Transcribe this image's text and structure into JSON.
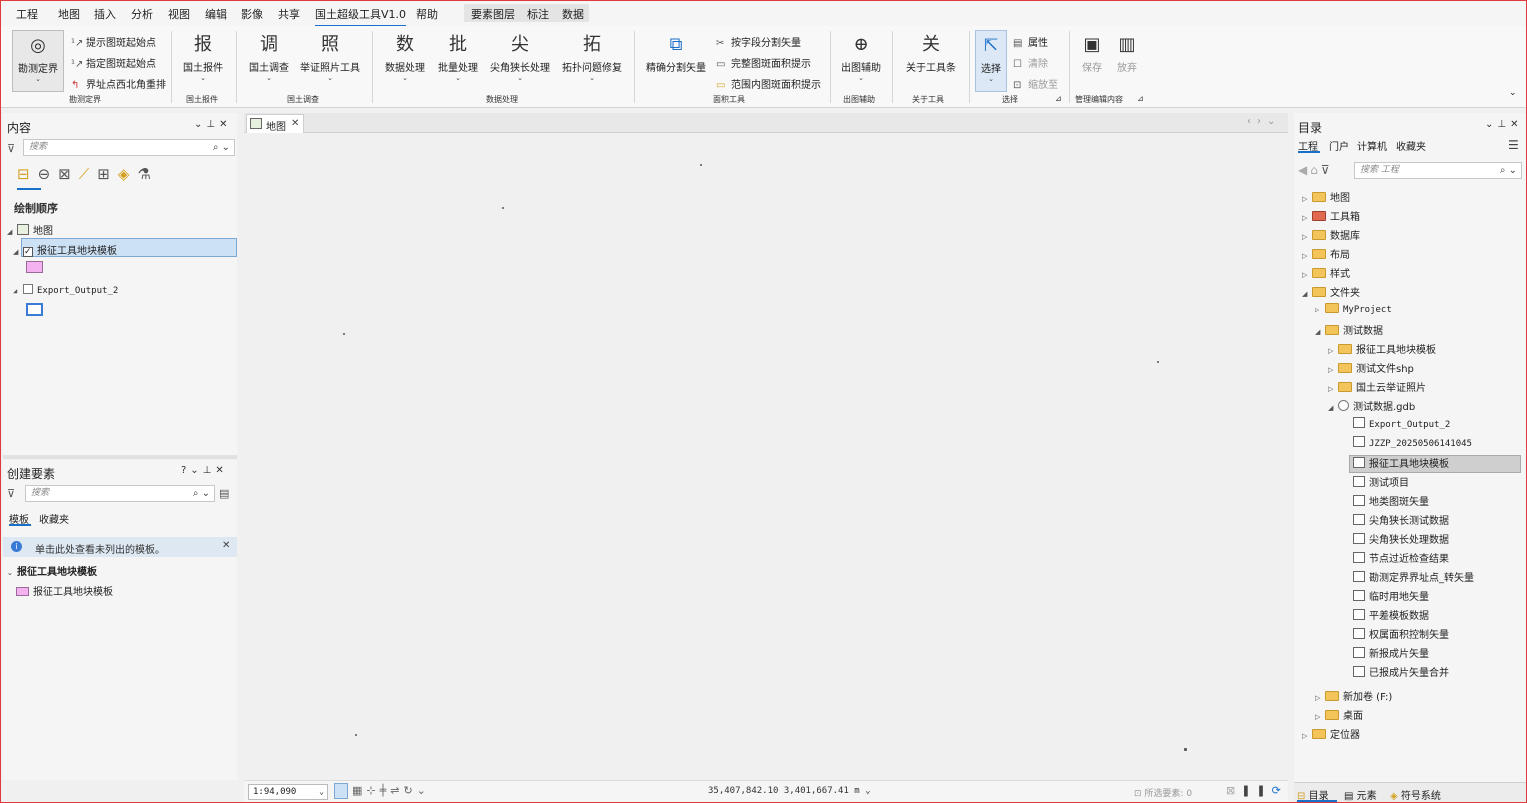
{
  "menu": [
    "工程",
    "地图",
    "插入",
    "分析",
    "视图",
    "编辑",
    "影像",
    "共享",
    "国土超级工具V1.0",
    "帮助"
  ],
  "context_tabs": [
    "要素图层",
    "标注",
    "数据"
  ],
  "ribbon": {
    "kcjd": {
      "big": "勘测定界",
      "items": [
        "提示图斑起始点",
        "指定图斑起始点",
        "界址点西北角重排"
      ],
      "group": "勘测定界"
    },
    "gtcj": {
      "big": "国土报件",
      "group": "国土报件"
    },
    "gtdc": {
      "big1": "国土调查",
      "big2": "举证照片工具",
      "group": "国土调查"
    },
    "sjcl": {
      "b1": "数据处理",
      "b2": "批量处理",
      "b3": "尖角狭长处理",
      "b4": "拓扑问题修复",
      "group": "数据处理"
    },
    "mjgj": {
      "big": "精确分割矢量",
      "items": [
        "按字段分割矢量",
        "完整图斑面积提示",
        "范围内图斑面积提示"
      ],
      "group": "面积工具"
    },
    "ctfz": {
      "big": "出图辅助",
      "group": "出图辅助"
    },
    "gygj": {
      "big": "关于工具条",
      "group": "关于工具"
    },
    "xz": {
      "big": "选择",
      "items": [
        "属性",
        "清除",
        "缩放至"
      ],
      "group": "选择"
    },
    "glbj": {
      "b1": "保存",
      "b2": "放弃",
      "group": "管理编辑内容"
    }
  },
  "contents": {
    "title": "内容",
    "search_placeholder": "搜索",
    "draw_order": "绘制顺序",
    "map": "地图",
    "layer1": "报征工具地块模板",
    "layer2": "Export_Output_2"
  },
  "create": {
    "title": "创建要素",
    "search_placeholder": "搜索",
    "tab1": "模板",
    "tab2": "收藏夹",
    "info": "单击此处查看未列出的模板。",
    "group": "报征工具地块模板",
    "item": "报征工具地块模板"
  },
  "map_tab": "地图",
  "catalog": {
    "title": "目录",
    "tabs": [
      "工程",
      "门户",
      "计算机",
      "收藏夹"
    ],
    "search_placeholder": "搜索 工程",
    "root": [
      "地图",
      "工具箱",
      "数据库",
      "布局",
      "样式",
      "文件夹"
    ],
    "myproject": "MyProject",
    "testdata": "测试数据",
    "sub": [
      "报征工具地块模板",
      "测试文件shp",
      "国土云举证照片"
    ],
    "gdb": "测试数据.gdb",
    "gdb_items": [
      "Export_Output_2",
      "JZZP_20250506141045",
      "报征工具地块模板",
      "测试项目",
      "地类图斑矢量",
      "尖角狭长测试数据",
      "尖角狭长处理数据",
      "节点过近检查结果",
      "勘测定界界址点_转矢量",
      "临时用地矢量",
      "平差模板数据",
      "权属面积控制矢量",
      "新报成片矢量",
      "已报成片矢量合并"
    ],
    "newvol": "新加卷 (F:)",
    "desktop": "桌面",
    "locator": "定位器",
    "bottom_tabs": [
      "目录",
      "元素",
      "符号系统"
    ]
  },
  "statusbar": {
    "scale": "1:94,090",
    "coords": "35,407,842.10 3,401,667.41 m",
    "selected_label": "所选要素:",
    "selected_count": "0"
  },
  "colors": {
    "accent": "#1a6fc9",
    "layer_fill": "#f4b3f0",
    "border": "#e03a3a"
  }
}
